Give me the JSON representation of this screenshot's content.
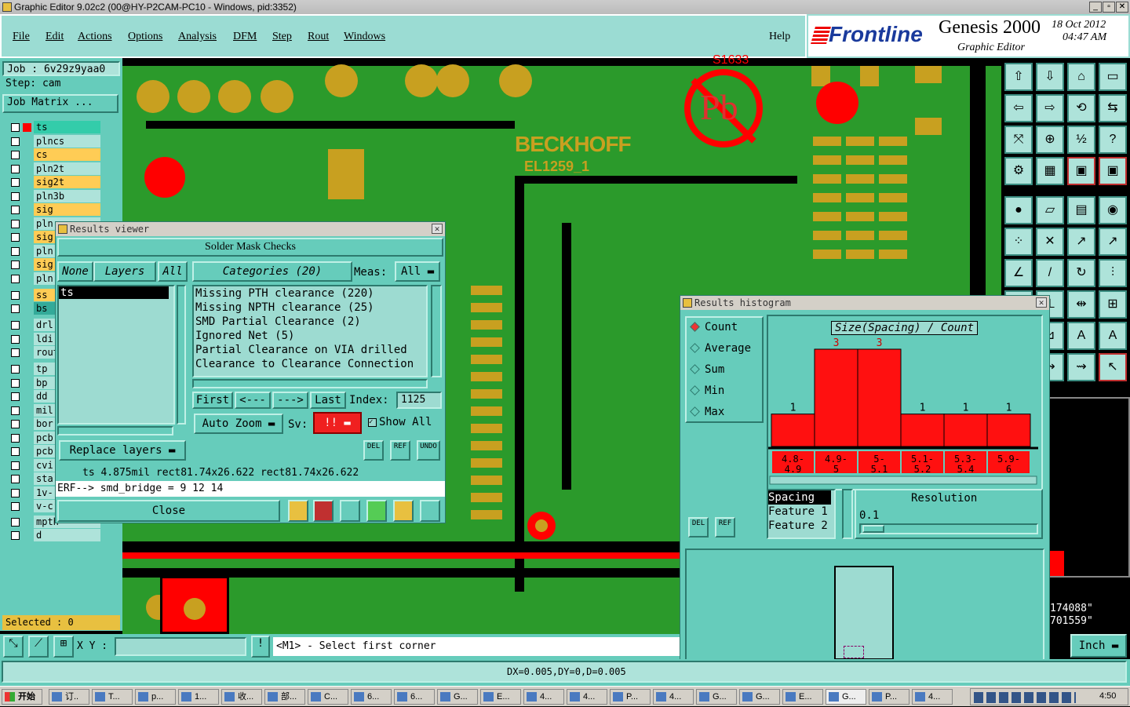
{
  "window": {
    "title": "Graphic Editor 9.02c2 (00@HY-P2CAM-PC10 - Windows, pid:3352)"
  },
  "menu": [
    "File",
    "Edit",
    "Actions",
    "Options",
    "Analysis",
    "DFM",
    "Step",
    "Rout",
    "Windows"
  ],
  "help": "Help",
  "brand": {
    "logo": "Frontline",
    "product": "Genesis 2000",
    "sub": "Graphic Editor",
    "date": "18 Oct 2012",
    "time": "04:47 AM"
  },
  "job": {
    "job": "Job : 6v29z9yaa0",
    "step": "Step: cam",
    "matrix": "Job Matrix ..."
  },
  "layers": [
    {
      "name": "ts",
      "color": "#33ccaa"
    },
    {
      "name": "plncs",
      "color": "#aee3da"
    },
    {
      "name": "cs",
      "color": "#ffcc55"
    },
    {
      "name": "pln2t",
      "color": "#aee3da"
    },
    {
      "name": "sig2t",
      "color": "#ffcc55"
    },
    {
      "name": "pln3b",
      "color": "#aee3da"
    },
    {
      "name": "sig",
      "color": "#ffcc55"
    },
    {
      "name": "pln",
      "color": "#aee3da"
    },
    {
      "name": "sig",
      "color": "#ffcc55"
    },
    {
      "name": "pln",
      "color": "#aee3da"
    },
    {
      "name": "sig",
      "color": "#ffcc55"
    },
    {
      "name": "pln",
      "color": "#aee3da"
    },
    {
      "name": "ss",
      "color": "#ffcc55"
    },
    {
      "name": "bs",
      "color": "#33aa99"
    },
    {
      "name": "drl",
      "color": "#aee3da"
    },
    {
      "name": "ldi",
      "color": "#aee3da"
    },
    {
      "name": "rout",
      "color": "#aee3da"
    },
    {
      "name": "tp",
      "color": "#aee3da"
    },
    {
      "name": "bp",
      "color": "#aee3da"
    },
    {
      "name": "dd",
      "color": "#aee3da"
    },
    {
      "name": "mil",
      "color": "#aee3da"
    },
    {
      "name": "bor",
      "color": "#aee3da"
    },
    {
      "name": "pcb",
      "color": "#aee3da"
    },
    {
      "name": "pcb",
      "color": "#aee3da"
    },
    {
      "name": "cvi",
      "color": "#aee3da"
    },
    {
      "name": "sta",
      "color": "#aee3da"
    },
    {
      "name": "1v-",
      "color": "#aee3da"
    },
    {
      "name": "v-c",
      "color": "#aee3da"
    },
    {
      "name": "mpth",
      "color": "#aee3da"
    },
    {
      "name": "d",
      "color": "#aee3da"
    }
  ],
  "selected": "Selected : 0",
  "board": {
    "brand": "BECKHOFF",
    "model": "EL1259_1",
    "pb": "Pb",
    "topcode": "S1633"
  },
  "results_viewer": {
    "title": "Results viewer",
    "header": "Solder Mask Checks",
    "none": "None",
    "layers": "Layers",
    "all": "All",
    "categories": "Categories (20)",
    "meas": "Meas:",
    "meas_val": "All",
    "layer_list": [
      "ts"
    ],
    "category_list": [
      "Missing PTH clearance (220)",
      "Missing NPTH clearance (25)",
      "SMD Partial Clearance (2)",
      "Ignored Net (5)",
      "Partial Clearance on VIA drilled",
      "Clearance to Clearance Connection"
    ],
    "first": "First",
    "prev": "<---",
    "next": "--->",
    "last": "Last",
    "index_label": "Index:",
    "index_val": "1125",
    "auto_zoom": "Auto Zoom",
    "sv": "Sv:",
    "sv_val": "!!",
    "show_all": "Show All",
    "replace_layers": "Replace layers",
    "del": "DEL",
    "ref": "REF",
    "undo": "UNDO",
    "status": "ts 4.875mil   rect81.74x26.622   rect81.74x26.622",
    "erf": "ERF--> smd_bridge = 9 12 14",
    "close": "Close"
  },
  "histogram": {
    "title": "Results histogram",
    "modes": [
      "Count",
      "Average",
      "Sum",
      "Min",
      "Max"
    ],
    "chart_title": "Size(Spacing) / Count",
    "spacing": "Spacing",
    "feature1": "Feature 1",
    "feature2": "Feature 2",
    "resolution": "Resolution",
    "res_val": "0.1",
    "del": "DEL",
    "ref": "REF"
  },
  "chart_data": {
    "type": "bar",
    "title": "Size(Spacing) / Count",
    "categories": [
      "4.8-4.9",
      "4.9-5",
      "5-5.1",
      "5.1-5.2",
      "5.3-5.4",
      "5.9-6"
    ],
    "values": [
      1,
      3,
      3,
      1,
      1,
      1
    ],
    "ylim": [
      0,
      3
    ]
  },
  "bottom": {
    "xy": "X Y :",
    "prompt": "<M1> - Select first corner",
    "unit": "Inch",
    "coords": "DX=0.005,DY=0,D=0.005",
    "coord1": "174088\"",
    "coord2": "701559\""
  },
  "taskbar": {
    "start": "开始",
    "clock": "4:50",
    "tasks": [
      "订..",
      "T...",
      "p...",
      "1...",
      "收...",
      "部...",
      "C...",
      "6...",
      "6...",
      "G...",
      "E...",
      "4...",
      "4...",
      "P...",
      "4...",
      "G...",
      "G...",
      "E...",
      "G...",
      "P...",
      "4..."
    ]
  }
}
